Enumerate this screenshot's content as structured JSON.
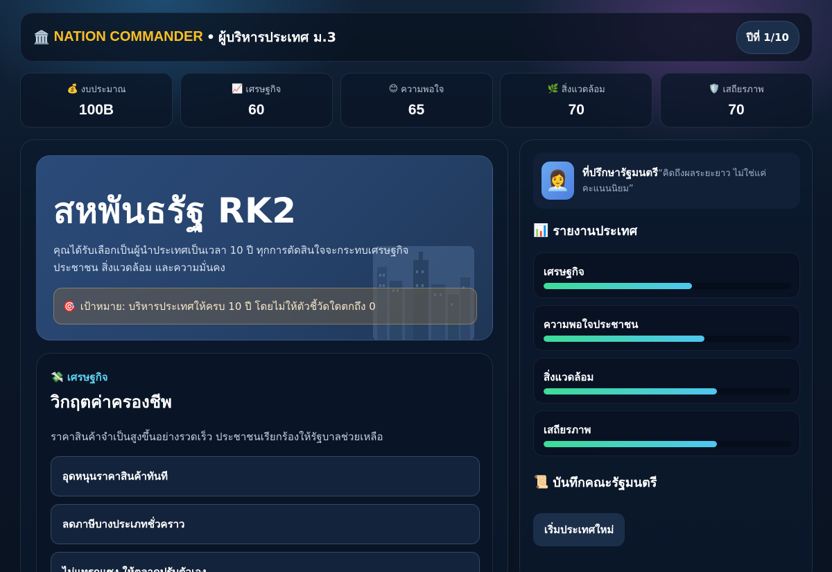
{
  "header": {
    "icon": "🏛️",
    "brand": "NATION COMMANDER",
    "separator": "•",
    "subtitle": "ผู้บริหารประเทศ ม.3",
    "year_label": "ปีที่ 1/10"
  },
  "stats": [
    {
      "icon": "💰",
      "label": "งบประมาณ",
      "value": "100B"
    },
    {
      "icon": "📈",
      "label": "เศรษฐกิจ",
      "value": "60"
    },
    {
      "icon": "😊",
      "label": "ความพอใจ",
      "value": "65"
    },
    {
      "icon": "🌿",
      "label": "สิ่งแวดล้อม",
      "value": "70"
    },
    {
      "icon": "🛡️",
      "label": "เสถียรภาพ",
      "value": "70"
    }
  ],
  "hero": {
    "title": "สหพันธรัฐ RK2",
    "description": "คุณได้รับเลือกเป็นผู้นำประเทศเป็นเวลา 10 ปี ทุกการตัดสินใจจะกระทบเศรษฐกิจ ประชาชน สิ่งแวดล้อม และความมั่นคง",
    "goal_icon": "🎯",
    "goal": "เป้าหมาย: บริหารประเทศให้ครบ 10 ปี โดยไม่ให้ตัวชี้วัดใดตกถึง 0"
  },
  "event": {
    "category_icon": "💸",
    "category": "เศรษฐกิจ",
    "title": "วิกฤตค่าครองชีพ",
    "description": "ราคาสินค้าจำเป็นสูงขึ้นอย่างรวดเร็ว ประชาชนเรียกร้องให้รัฐบาลช่วยเหลือ",
    "choices": [
      "อุดหนุนราคาสินค้าทันที",
      "ลดภาษีบางประเภทชั่วคราว",
      "ไม่แทรกแซง ให้ตลาดปรับตัวเอง"
    ]
  },
  "advisor": {
    "avatar": "👩‍💼",
    "name": "ที่ปรึกษารัฐมนตรี",
    "quote": "“คิดถึงผลระยะยาว ไม่ใช่แค่คะแนนนิยม”"
  },
  "report": {
    "icon": "📊",
    "title": "รายงานประเทศ",
    "meters": [
      {
        "label": "เศรษฐกิจ",
        "value": 60
      },
      {
        "label": "ความพอใจประชาชน",
        "value": 65
      },
      {
        "label": "สิ่งแวดล้อม",
        "value": 70
      },
      {
        "label": "เสถียรภาพ",
        "value": 70
      }
    ]
  },
  "cabinet": {
    "icon": "📜",
    "title": "บันทึกคณะรัฐมนตรี",
    "restart_label": "เริ่มประเทศใหม่"
  },
  "colors": {
    "brand": "#fbbf24",
    "accent": "#5fd3f0",
    "meter_start": "#3ddc97",
    "meter_end": "#4fc6f0"
  }
}
